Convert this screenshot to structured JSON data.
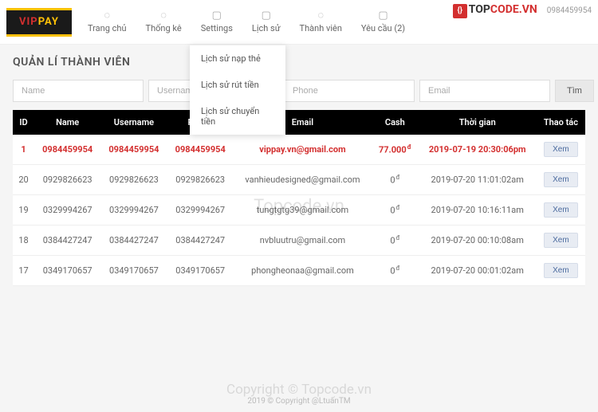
{
  "logo": {
    "v": "VIP",
    "p": "PAY"
  },
  "topBrand": {
    "t": "TOP",
    "rest": "CODE.VN"
  },
  "userNum": "0984459954",
  "nav": [
    {
      "label": "Trang chủ"
    },
    {
      "label": "Thống kê"
    },
    {
      "label": "Settings"
    },
    {
      "label": "Lịch sử"
    },
    {
      "label": "Thành viên"
    },
    {
      "label": "Yêu cầu (2)"
    }
  ],
  "dropdown": [
    "Lịch sử nạp thẻ",
    "Lịch sử rút tiền",
    "Lịch sử chuyển tiền"
  ],
  "pageTitle": "QUẢN LÍ THÀNH VIÊN",
  "filters": {
    "name": "Name",
    "username": "Username",
    "phone": "Phone",
    "email": "Email",
    "search": "Tìm"
  },
  "columns": {
    "id": "ID",
    "name": "Name",
    "username": "Username",
    "phone": "Phone",
    "email": "Email",
    "cash": "Cash",
    "time": "Thời gian",
    "action": "Thao tác"
  },
  "actionLabel": "Xem",
  "rows": [
    {
      "id": "1",
      "name": "0984459954",
      "username": "0984459954",
      "phone": "0984459954",
      "email": "vippay.vn@gmail.com",
      "cash": "77.000",
      "time": "2019-07-19 20:30:06pm",
      "hl": true
    },
    {
      "id": "20",
      "name": "0929826623",
      "username": "0929826623",
      "phone": "0929826623",
      "email": "vanhieudesigned@gmail.com",
      "cash": "0",
      "time": "2019-07-20 11:01:02am"
    },
    {
      "id": "19",
      "name": "0329994267",
      "username": "0329994267",
      "phone": "0329994267",
      "email": "tungtgtg39@gmail.com",
      "cash": "0",
      "time": "2019-07-20 10:16:11am"
    },
    {
      "id": "18",
      "name": "0384427247",
      "username": "0384427247",
      "phone": "0384427247",
      "email": "nvbluutru@gmail.com",
      "cash": "0",
      "time": "2019-07-20 00:10:08am"
    },
    {
      "id": "17",
      "name": "0349170657",
      "username": "0349170657",
      "phone": "0349170657",
      "email": "phongheonaa@gmail.com",
      "cash": "0",
      "time": "2019-07-20 00:01:02am"
    }
  ],
  "watermark": "Topcode.vn",
  "watermark2": "Copyright © Topcode.vn",
  "footer": "2019 © Copyright @LtuấnTM"
}
